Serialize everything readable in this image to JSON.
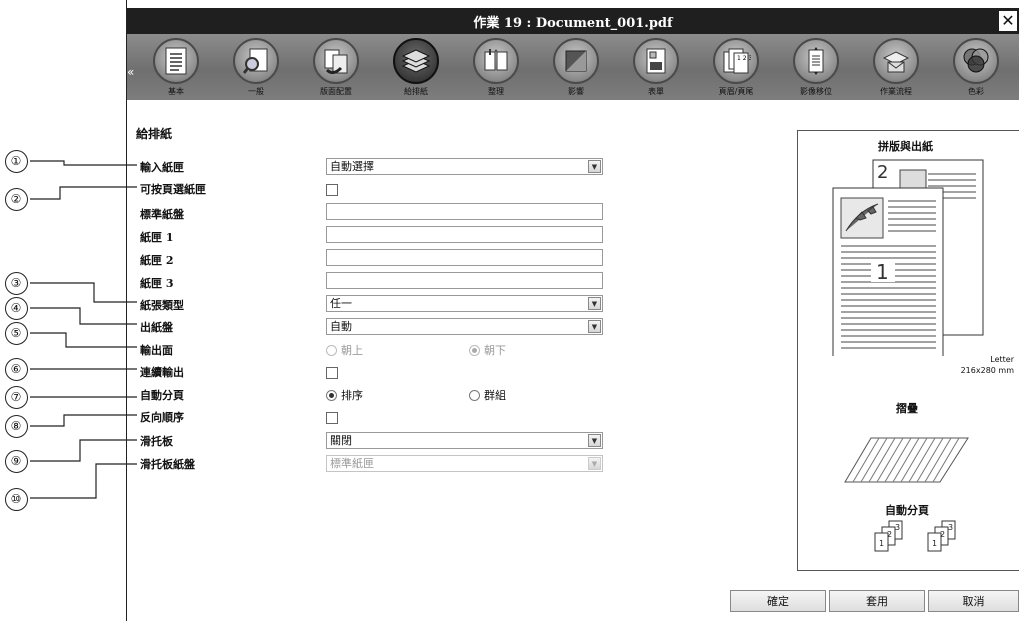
{
  "window": {
    "title": "作業 19 : Document_001.pdf",
    "close_glyph": "✕"
  },
  "toolbar": {
    "scroll_left_glyph": "«",
    "items": [
      {
        "label": "基本",
        "icon": "document-icon"
      },
      {
        "label": "一般",
        "icon": "magnifier-page-icon"
      },
      {
        "label": "版面配置",
        "icon": "page-layout-icon"
      },
      {
        "label": "給排紙",
        "icon": "paper-stack-icon",
        "active": true
      },
      {
        "label": "整理",
        "icon": "staple-finishing-icon"
      },
      {
        "label": "影響",
        "icon": "image-quality-icon"
      },
      {
        "label": "表單",
        "icon": "form-overlay-icon"
      },
      {
        "label": "頁眉/頁尾",
        "icon": "header-footer-icon"
      },
      {
        "label": "影像移位",
        "icon": "image-shift-icon"
      },
      {
        "label": "作業流程",
        "icon": "workflow-icon"
      },
      {
        "label": "色彩",
        "icon": "color-circles-icon"
      }
    ]
  },
  "callouts": [
    "①",
    "②",
    "③",
    "④",
    "⑤",
    "⑥",
    "⑦",
    "⑧",
    "⑨",
    "⑩"
  ],
  "section": {
    "title": "給排紙"
  },
  "form": {
    "input_tray": {
      "label": "輸入紙匣",
      "value": "自動選擇"
    },
    "page_tray": {
      "label": "可按頁選紙匣"
    },
    "standard_tray": {
      "label": "標準紙盤"
    },
    "tray1": {
      "label": "紙匣 1"
    },
    "tray2": {
      "label": "紙匣 2"
    },
    "tray3": {
      "label": "紙匣 3"
    },
    "paper_type": {
      "label": "紙張類型",
      "value": "任一"
    },
    "output_tray": {
      "label": "出紙盤",
      "value": "自動"
    },
    "output_face": {
      "label": "輸出面",
      "option_up": "朝上",
      "option_down": "朝下"
    },
    "continuous_output": {
      "label": "連續輸出"
    },
    "collate": {
      "label": "自動分頁",
      "option_sort": "排序",
      "option_group": "群組"
    },
    "reverse_order": {
      "label": "反向順序"
    },
    "slip_sheet": {
      "label": "滑托板",
      "value": "關閉"
    },
    "slip_tray": {
      "label": "滑托板紙盤",
      "value": "標準紙匣"
    }
  },
  "preview": {
    "title": "拼版與出紙",
    "page_front_number": "1",
    "page_back_number": "2",
    "paper_name": "Letter",
    "paper_size": "216x280 mm",
    "fold_title": "摺疊",
    "collate_title": "自動分頁",
    "set_numbers": [
      "1",
      "2",
      "3"
    ]
  },
  "buttons": {
    "ok": "確定",
    "apply": "套用",
    "cancel": "取消"
  }
}
